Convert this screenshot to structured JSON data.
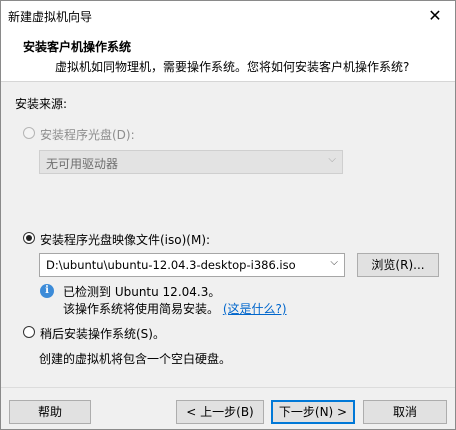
{
  "window": {
    "title": "新建虚拟机向导",
    "close": "✕"
  },
  "header": {
    "title": "安装客户机操作系统",
    "subtitle": "虚拟机如同物理机，需要操作系统。您将如何安装客户机操作系统?"
  },
  "source": {
    "label": "安装来源:",
    "disc": {
      "label": "安装程序光盘(D):",
      "value": "无可用驱动器"
    },
    "iso": {
      "label": "安装程序光盘映像文件(iso)(M):",
      "value": "D:\\ubuntu\\ubuntu-12.04.3-desktop-i386.iso",
      "browse": "浏览(R)..."
    },
    "detect": {
      "line1": "已检测到 Ubuntu 12.04.3。",
      "line2": "该操作系统将使用简易安装。",
      "link": "(这是什么?)"
    },
    "later": {
      "label": "稍后安装操作系统(S)。",
      "desc": "创建的虚拟机将包含一个空白硬盘。"
    }
  },
  "footer": {
    "help": "帮助",
    "back": "< 上一步(B)",
    "next": "下一步(N) >",
    "cancel": "取消"
  },
  "icons": {
    "info": "i",
    "dropdown": "⌵"
  }
}
